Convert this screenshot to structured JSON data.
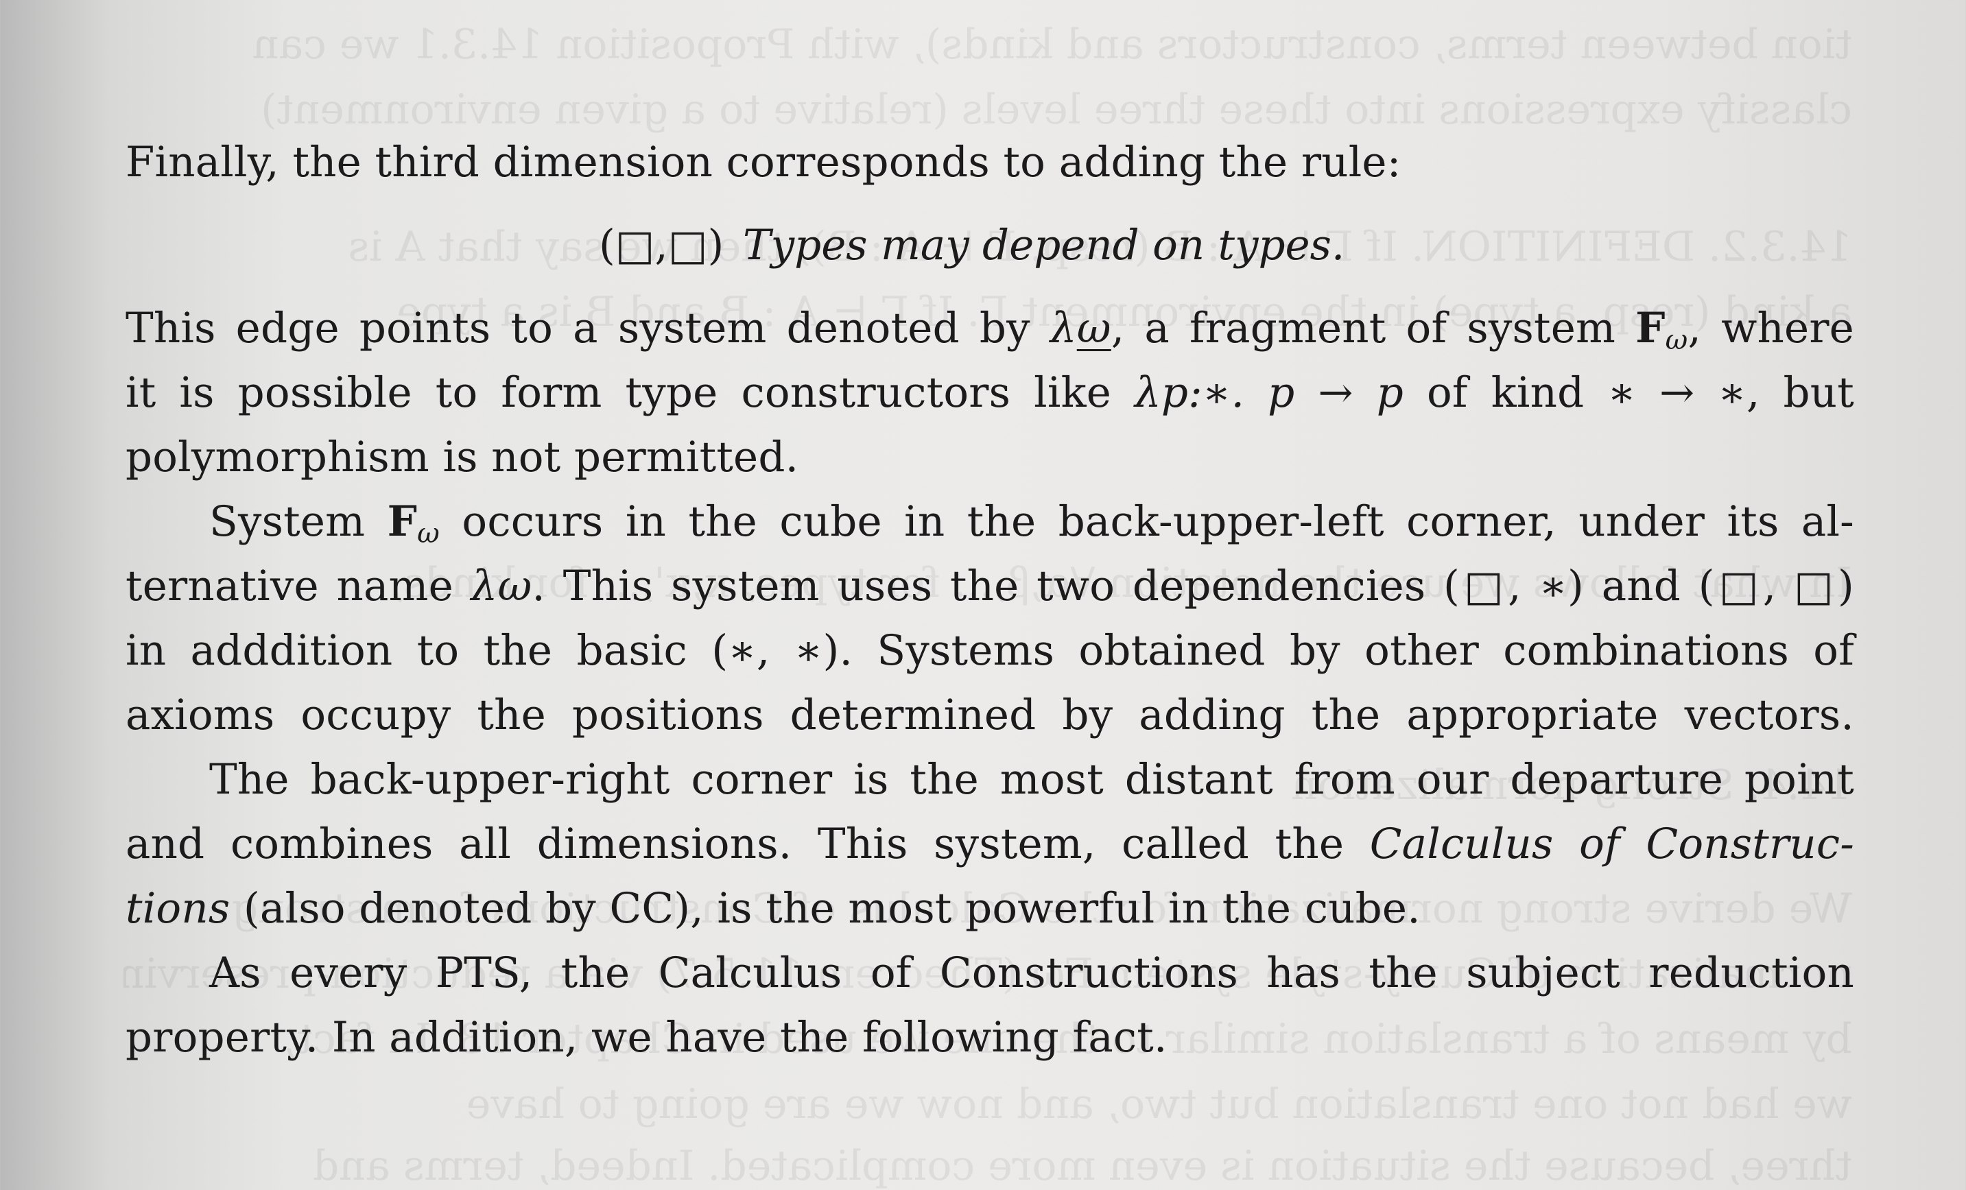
{
  "bleed_through": [
    "tion between terms, constructors and kinds), with Proposition 14.3.1 we can",
    "classify expressions into these three levels (relative to a given environment)",
    "14.3.2. DEFINITION. If Γ ⊢ A : B (resp. Γ ⊢ A : B), then we say that A is",
    "a kind (resp. a type) in the environment Γ. If Γ ⊢ A : B and B is a type",
    "In what follows we use the notation ∀α,β,... for types, κ,κ',... for kinds,",
    "14.4. Strong normalization",
    "We derive strong normalization for the Calculus of Constructions from strong",
    "normalization of Curry-style system Fω (Theorem 11.5.7) via a reduction-preserving",
    "by means of a translation similar to the one we used in Chapter 13. In fact,",
    "we had not one translation but two, and now we are going to have",
    "three, because the situation is even more complicated. Indeed, terms and"
  ],
  "paragraphs": {
    "p1_line1": "Finally, the third dimension corresponds to adding the rule:",
    "display_rule": {
      "pair": "(□,□)",
      "text": "Types may depend on types."
    },
    "p2_line1": {
      "a": "This edge points to a system denoted by ",
      "lambda": "λ",
      "omega_underlined": "ω",
      "b": ", a fragment of system ",
      "F": "F",
      "sub": "ω",
      "c": ", where"
    },
    "p2_line2": {
      "a": "it is possible to form type constructors like ",
      "math": "λp:∗. p → p",
      "b": " of kind ∗ → ∗, but"
    },
    "p2_line3": "polymorphism is not permitted.",
    "p3_line1": {
      "a": "System ",
      "F": "F",
      "sub": "ω",
      "b": " occurs in the cube in the back-upper-left corner, under its al-"
    },
    "p3_line2": {
      "a": "ternative name ",
      "math": "λω",
      "b": ". This system uses the two dependencies (□, ∗) and (□, □)"
    },
    "p3_line3": "in adddition to the basic (∗, ∗). Systems obtained by other combinations of",
    "p3_line4": "axioms occupy the positions determined by adding the appropriate vectors.",
    "p4_line1": "The back-upper-right corner is the most distant from our departure point",
    "p4_line2": {
      "a": "and combines all dimensions. This system, called the ",
      "italic": "Calculus of Construc-"
    },
    "p4_line3": {
      "italic": "tions",
      "b": " (also denoted by CC), is the most powerful in the cube."
    },
    "p5_line1": "As every PTS, the Calculus of Constructions has the subject reduction",
    "p5_line2": "property. In addition, we have the following fact."
  }
}
